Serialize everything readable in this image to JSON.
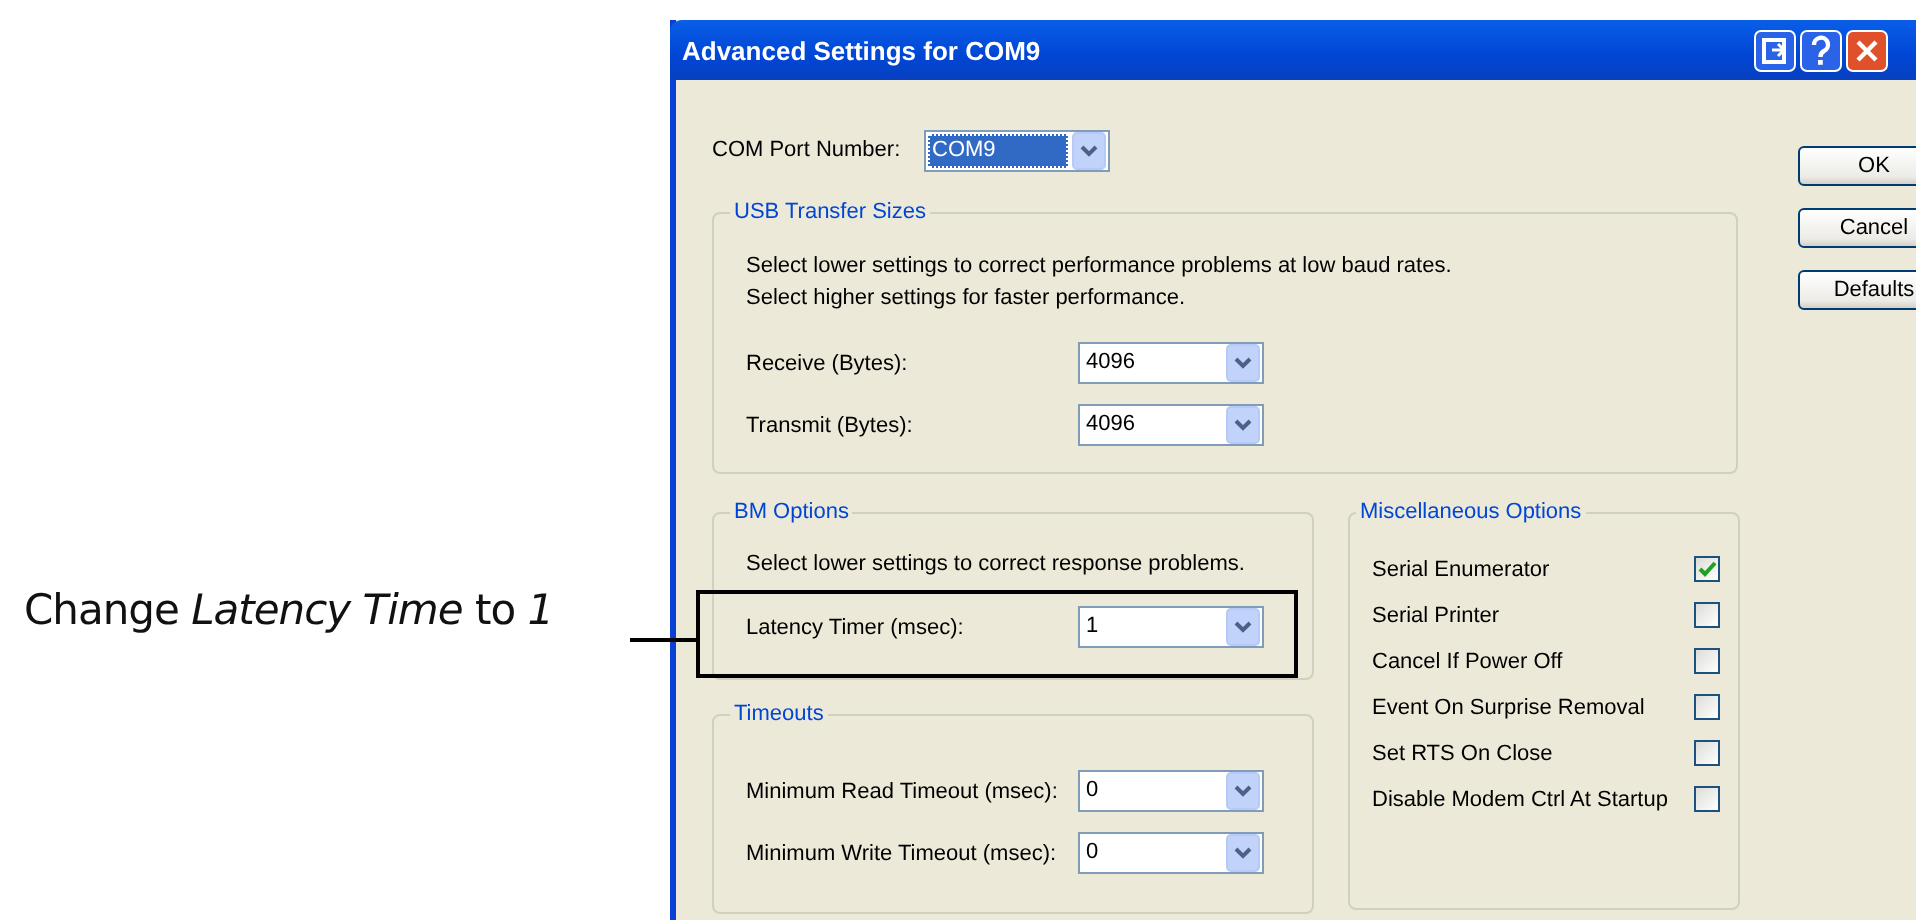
{
  "instruction": "Change *Latency Time* to *1*",
  "window": {
    "title": "Advanced Settings for COM9"
  },
  "com_port": {
    "label": "COM Port Number:",
    "value": "COM9",
    "focused": true
  },
  "buttons": [
    "OK",
    "Cancel",
    "Defaults"
  ],
  "usb_transfer_sizes": {
    "title": "USB Transfer Sizes",
    "description": [
      "Select lower settings to correct performance problems at low baud rates.",
      "Select higher settings for faster performance."
    ],
    "fields": [
      {
        "label": "Receive (Bytes):",
        "value": "4096"
      },
      {
        "label": "Transmit (Bytes):",
        "value": "4096"
      }
    ]
  },
  "bm_options": {
    "title": "BM Options",
    "description": [
      "Select lower settings to correct response problems."
    ],
    "fields": [
      {
        "label": "Latency Timer (msec):",
        "value": "1"
      }
    ]
  },
  "timeouts": {
    "title": "Timeouts",
    "fields": [
      {
        "label": "Minimum Read Timeout (msec):",
        "value": "0"
      },
      {
        "label": "Minimum Write Timeout (msec):",
        "value": "0"
      }
    ]
  },
  "misc_options": {
    "title": "Miscellaneous Options",
    "items": [
      {
        "label": "Serial Enumerator",
        "checked": true
      },
      {
        "label": "Serial Printer",
        "checked": false
      },
      {
        "label": "Cancel If Power Off",
        "checked": false
      },
      {
        "label": "Event On Surprise Removal",
        "checked": false
      },
      {
        "label": "Set RTS On Close",
        "checked": false
      },
      {
        "label": "Disable Modem Ctrl At Startup",
        "checked": false
      }
    ]
  }
}
